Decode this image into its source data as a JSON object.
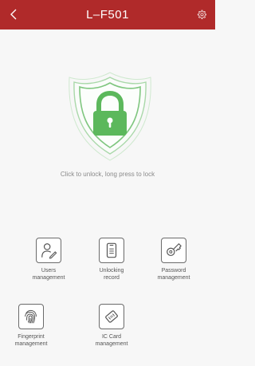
{
  "header": {
    "title": "L–F501",
    "back_icon": "chevron-left-icon",
    "settings_icon": "gear-icon",
    "background": "#b02a2a"
  },
  "lock": {
    "icon": "padlock-shield-icon",
    "accent": "#5cb85c",
    "hint": "Click to unlock, long press to lock"
  },
  "menu": {
    "items": [
      {
        "label": "Users\nmanagement",
        "icon": "user-edit-icon"
      },
      {
        "label": "Unlocking\nrecord",
        "icon": "phone-record-icon"
      },
      {
        "label": "Password\nmanagement",
        "icon": "key-icon"
      },
      {
        "label": "Fingerprint\nmanagement",
        "icon": "fingerprint-icon"
      },
      {
        "label": "IC Card\nmanagement",
        "icon": "ic-card-icon"
      }
    ]
  }
}
